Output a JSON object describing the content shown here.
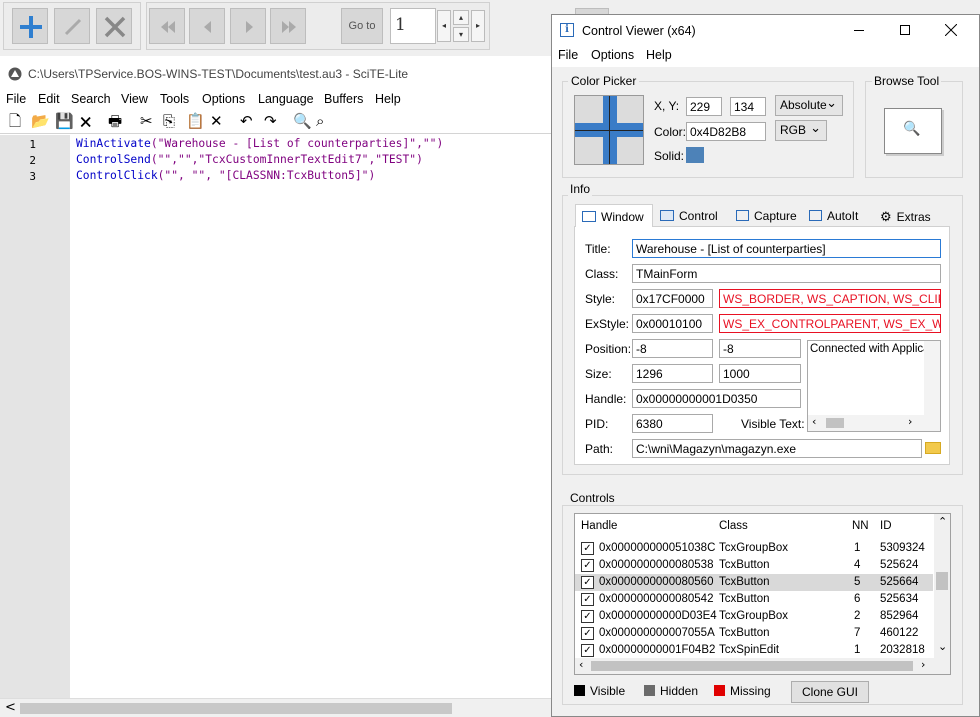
{
  "app_toolbar": {
    "goto_label": "Go to",
    "page_value": "1"
  },
  "scite": {
    "title": "C:\\Users\\TPService.BOS-WINS-TEST\\Documents\\test.au3 - SciTE-Lite",
    "menu": [
      "File",
      "Edit",
      "Search",
      "View",
      "Tools",
      "Options",
      "Language",
      "Buffers",
      "Help"
    ],
    "line_numbers": [
      "1",
      "2",
      "3"
    ],
    "code": [
      {
        "fn": "WinActivate",
        "args": "(\"Warehouse - [List of counterparties]\",\"\")"
      },
      {
        "fn": "ControlSend",
        "args": "(\"\",\"\",\"TcxCustomInnerTextEdit7\",\"TEST\")"
      },
      {
        "fn": "ControlClick",
        "args": "(\"\", \"\", \"[CLASSNN:TcxButton5]\")"
      }
    ],
    "scroll_left": "<"
  },
  "control_viewer": {
    "title": "Control Viewer (x64)",
    "menu": [
      "File",
      "Options",
      "Help"
    ],
    "color_picker": {
      "group_label": "Color Picker",
      "xy_label": "X, Y:",
      "x": "229",
      "y": "134",
      "coord_mode": "Absolute",
      "color_label": "Color:",
      "color_value": "0x4D82B8",
      "color_format": "RGB",
      "solid_label": "Solid:",
      "solid_color": "#4d82b8"
    },
    "browse_tool": {
      "group_label": "Browse Tool"
    },
    "info": {
      "group_label": "Info",
      "tabs": [
        "Window",
        "Control",
        "Capture",
        "AutoIt",
        "Extras"
      ],
      "title_label": "Title:",
      "title_value": "Warehouse - [List of counterparties]",
      "class_label": "Class:",
      "class_value": "TMainForm",
      "style_label": "Style:",
      "style_value": "0x17CF0000",
      "style_flags": "WS_BORDER, WS_CAPTION, WS_CLIPCH",
      "exstyle_label": "ExStyle:",
      "exstyle_value": "0x00010100",
      "exstyle_flags": "WS_EX_CONTROLPARENT, WS_EX_WINI",
      "position_label": "Position:",
      "pos_x": "-8",
      "pos_y": "-8",
      "size_label": "Size:",
      "width": "1296",
      "height": "1000",
      "handle_label": "Handle:",
      "handle_value": "0x00000000001D0350",
      "pid_label": "PID:",
      "pid_value": "6380",
      "visible_text_label": "Visible Text:",
      "visible_text_value": "Connected with Applica",
      "path_label": "Path:",
      "path_value": "C:\\wni\\Magazyn\\magazyn.exe"
    },
    "controls": {
      "group_label": "Controls",
      "columns": [
        "Handle",
        "Class",
        "NN",
        "ID"
      ],
      "rows": [
        {
          "handle": "0x000000000051038C",
          "class": "TcxGroupBox",
          "nn": "1",
          "id": "5309324"
        },
        {
          "handle": "0x0000000000080538",
          "class": "TcxButton",
          "nn": "4",
          "id": "525624"
        },
        {
          "handle": "0x0000000000080560",
          "class": "TcxButton",
          "nn": "5",
          "id": "525664"
        },
        {
          "handle": "0x0000000000080542",
          "class": "TcxButton",
          "nn": "6",
          "id": "525634"
        },
        {
          "handle": "0x00000000000D03E4",
          "class": "TcxGroupBox",
          "nn": "2",
          "id": "852964"
        },
        {
          "handle": "0x000000000007055A",
          "class": "TcxButton",
          "nn": "7",
          "id": "460122"
        },
        {
          "handle": "0x00000000001F04B2",
          "class": "TcxSpinEdit",
          "nn": "1",
          "id": "2032818"
        }
      ],
      "selected_row": 2,
      "legend": [
        {
          "label": "Visible",
          "color": "#000000"
        },
        {
          "label": "Hidden",
          "color": "#6b6b6b"
        },
        {
          "label": "Missing",
          "color": "#e00000"
        }
      ],
      "clone_label": "Clone GUI"
    }
  }
}
